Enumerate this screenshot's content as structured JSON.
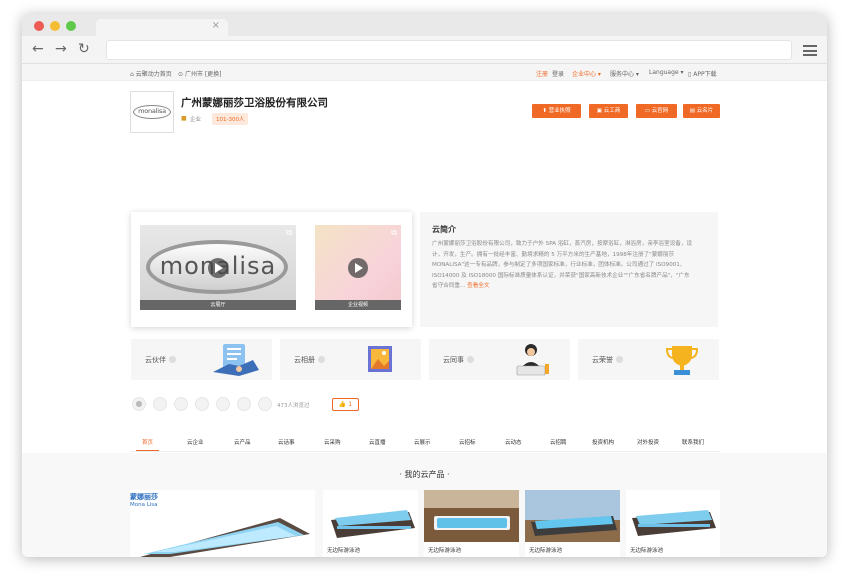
{
  "topnav": {
    "home": "云聚动力首页",
    "location": "广州市 [更换]",
    "register": "注册",
    "login": "登录",
    "enterprise_center": "企业中心",
    "service_center": "服务中心",
    "language": "Language",
    "app": "APP下载"
  },
  "company": {
    "logo_text": "monalisa",
    "name": "广州蒙娜丽莎卫浴股份有限公司",
    "tag_type": "企业",
    "tag_size": "101-300人"
  },
  "actions": {
    "license": "营业执照",
    "cloud_shop": "云工商",
    "website": "云官网",
    "card": "云名片"
  },
  "media": {
    "hall_label": "云展厅",
    "video_label": "企业视频",
    "big_logo": "monalisa"
  },
  "intro": {
    "title": "云简介",
    "text": "广州蒙娜丽莎卫浴股份有限公司，致力于户外 SPA 浴缸，蒸汽房，按摩浴缸，淋浴房，亲李浴室设备，设计，开发，生产。拥有一批经丰富、勤境求精的 5 万平方米的生产基地，1998年注册了\"蒙娜丽莎MONALISA\"这一专有品牌，参与制定了多项国家标准，行业标准，团体标准。公司通过了 ISO9001、ISO14000 及 ISO18000 国际标准质量体系认证，并荣获\"国家高新技术企业\"\"广东省名牌产品\"，\"广东省守合同重...",
    "more": "查看全文"
  },
  "cards": [
    {
      "label": "云伙伴"
    },
    {
      "label": "云相册"
    },
    {
      "label": "云同事"
    },
    {
      "label": "云荣誉"
    }
  ],
  "visit": {
    "text": "473人浏览过",
    "like": "1"
  },
  "menu": [
    "首页",
    "云企业",
    "云产品",
    "云话事",
    "云采购",
    "云直播",
    "云展示",
    "云招标",
    "云动态",
    "云招聘",
    "投资机构",
    "对外投资",
    "联系我们"
  ],
  "section": {
    "title": "· 我的云产品 ·"
  },
  "products": [
    {
      "brand": "蒙娜丽莎",
      "brand_en": "Mona  Lisa",
      "caption": ""
    },
    {
      "caption": "无边际游泳池"
    },
    {
      "caption": "无边际游泳池"
    },
    {
      "caption": "无边际游泳池"
    },
    {
      "caption": "无边际游泳池"
    }
  ],
  "colors": {
    "accent": "#f06a26",
    "panel_bg": "#f6f6f6"
  }
}
